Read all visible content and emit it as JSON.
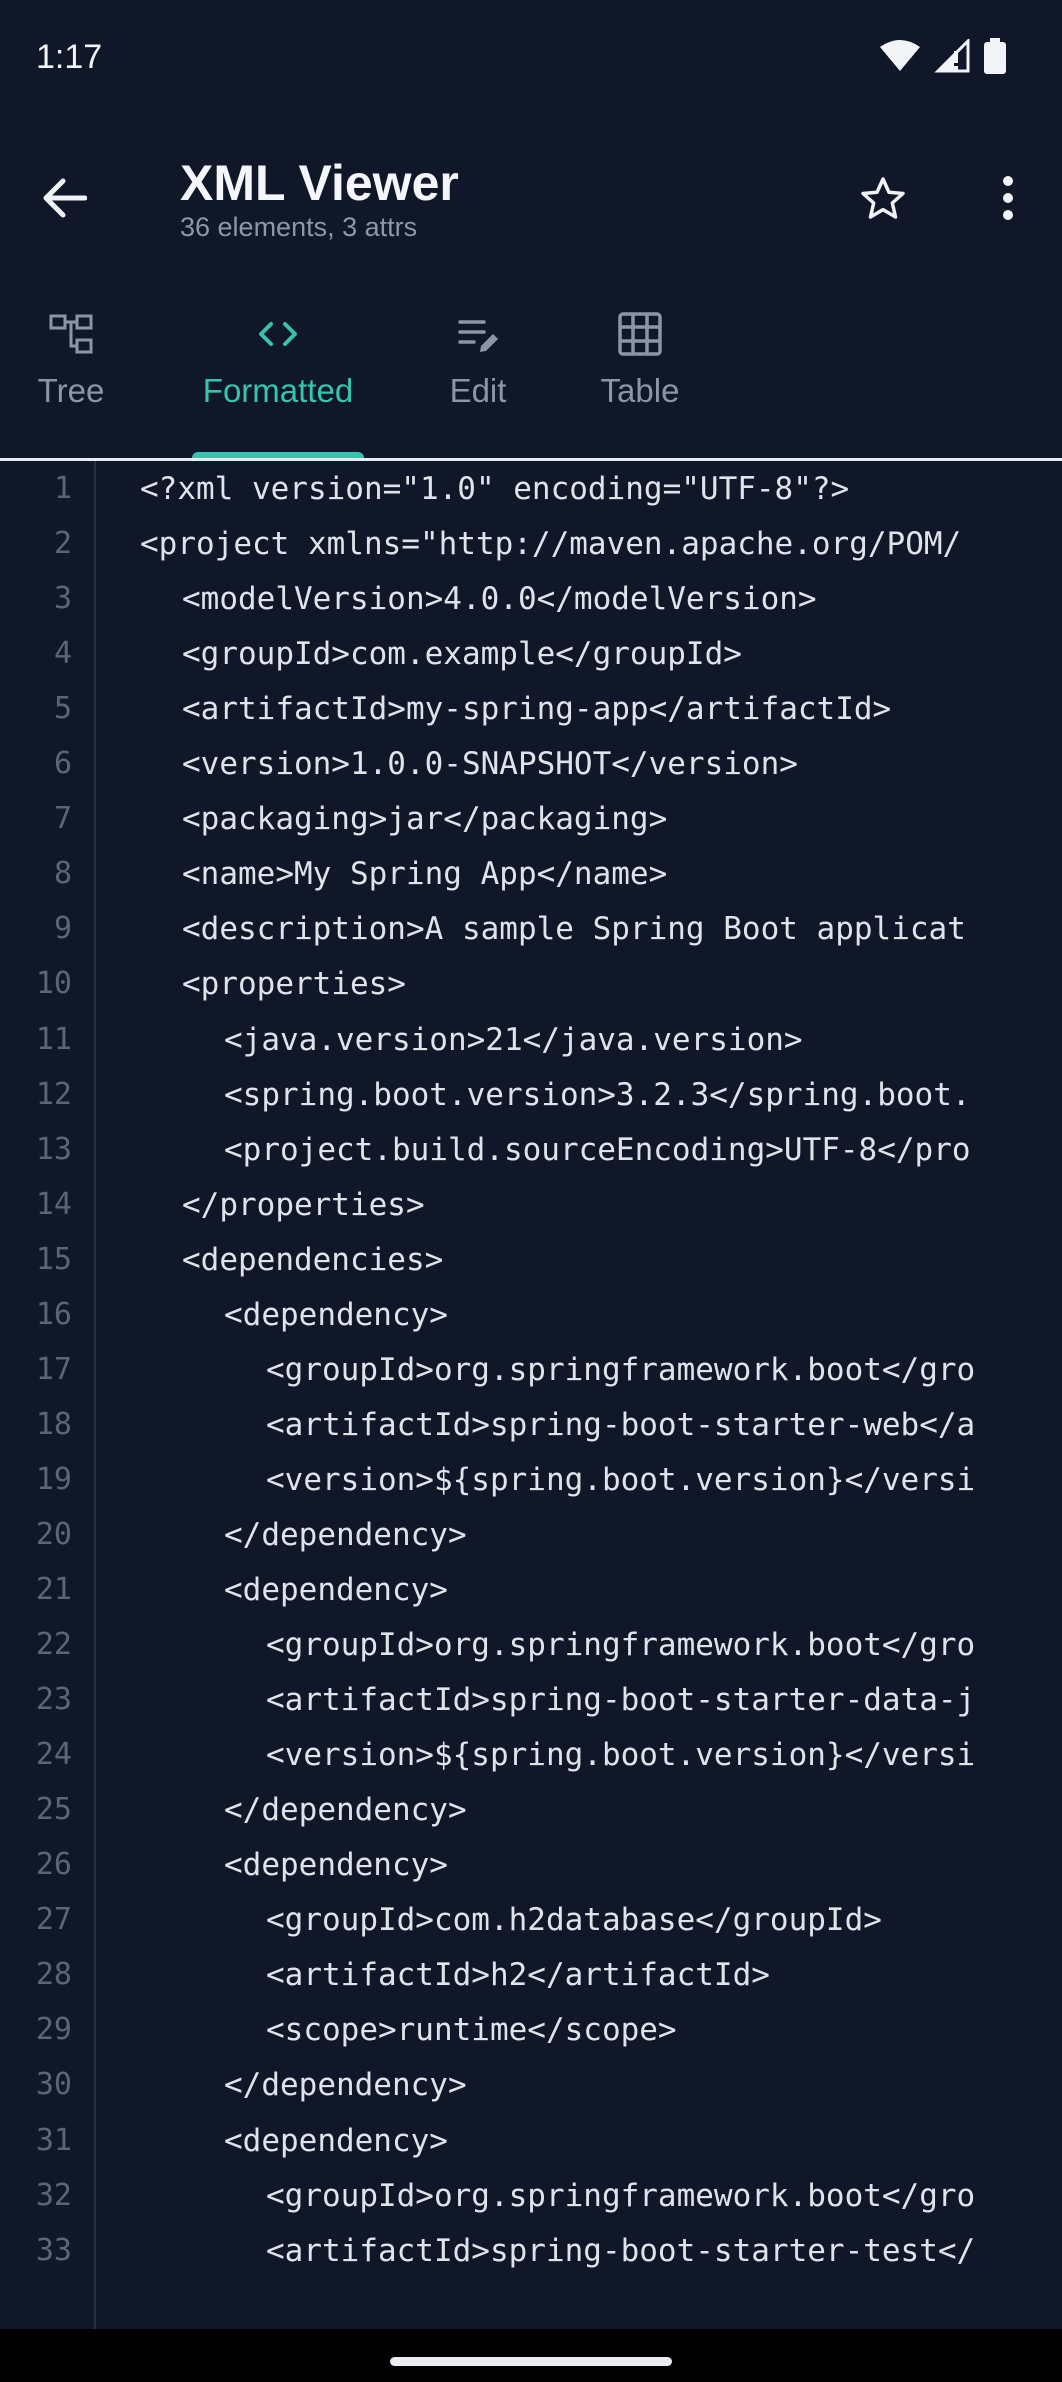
{
  "status_bar": {
    "time": "1:17"
  },
  "app_bar": {
    "title": "XML Viewer",
    "subtitle": "36 elements, 3 attrs"
  },
  "tabs": [
    {
      "label": "Tree",
      "icon": "tree-icon",
      "active": false
    },
    {
      "label": "Formatted",
      "icon": "code-icon",
      "active": true
    },
    {
      "label": "Edit",
      "icon": "edit-icon",
      "active": false
    },
    {
      "label": "Table",
      "icon": "table-icon",
      "active": false
    }
  ],
  "lines": [
    {
      "num": "1",
      "indent": 0,
      "code": "<?xml version=\"1.0\" encoding=\"UTF-8\"?>"
    },
    {
      "num": "2",
      "indent": 0,
      "code": "<project xmlns=\"http://maven.apache.org/POM/"
    },
    {
      "num": "3",
      "indent": 1,
      "code": "<modelVersion>4.0.0</modelVersion>"
    },
    {
      "num": "4",
      "indent": 1,
      "code": "<groupId>com.example</groupId>"
    },
    {
      "num": "5",
      "indent": 1,
      "code": "<artifactId>my-spring-app</artifactId>"
    },
    {
      "num": "6",
      "indent": 1,
      "code": "<version>1.0.0-SNAPSHOT</version>"
    },
    {
      "num": "7",
      "indent": 1,
      "code": "<packaging>jar</packaging>"
    },
    {
      "num": "8",
      "indent": 1,
      "code": "<name>My Spring App</name>"
    },
    {
      "num": "9",
      "indent": 1,
      "code": "<description>A sample Spring Boot applicat"
    },
    {
      "num": "10",
      "indent": 1,
      "code": "<properties>"
    },
    {
      "num": "11",
      "indent": 2,
      "code": "<java.version>21</java.version>"
    },
    {
      "num": "12",
      "indent": 2,
      "code": "<spring.boot.version>3.2.3</spring.boot."
    },
    {
      "num": "13",
      "indent": 2,
      "code": "<project.build.sourceEncoding>UTF-8</pro"
    },
    {
      "num": "14",
      "indent": 1,
      "code": "</properties>"
    },
    {
      "num": "15",
      "indent": 1,
      "code": "<dependencies>"
    },
    {
      "num": "16",
      "indent": 2,
      "code": "<dependency>"
    },
    {
      "num": "17",
      "indent": 3,
      "code": "<groupId>org.springframework.boot</gro"
    },
    {
      "num": "18",
      "indent": 3,
      "code": "<artifactId>spring-boot-starter-web</a"
    },
    {
      "num": "19",
      "indent": 3,
      "code": "<version>${spring.boot.version}</versi"
    },
    {
      "num": "20",
      "indent": 2,
      "code": "</dependency>"
    },
    {
      "num": "21",
      "indent": 2,
      "code": "<dependency>"
    },
    {
      "num": "22",
      "indent": 3,
      "code": "<groupId>org.springframework.boot</gro"
    },
    {
      "num": "23",
      "indent": 3,
      "code": "<artifactId>spring-boot-starter-data-j"
    },
    {
      "num": "24",
      "indent": 3,
      "code": "<version>${spring.boot.version}</versi"
    },
    {
      "num": "25",
      "indent": 2,
      "code": "</dependency>"
    },
    {
      "num": "26",
      "indent": 2,
      "code": "<dependency>"
    },
    {
      "num": "27",
      "indent": 3,
      "code": "<groupId>com.h2database</groupId>"
    },
    {
      "num": "28",
      "indent": 3,
      "code": "<artifactId>h2</artifactId>"
    },
    {
      "num": "29",
      "indent": 3,
      "code": "<scope>runtime</scope>"
    },
    {
      "num": "30",
      "indent": 2,
      "code": "</dependency>"
    },
    {
      "num": "31",
      "indent": 2,
      "code": "<dependency>"
    },
    {
      "num": "32",
      "indent": 3,
      "code": "<groupId>org.springframework.boot</gro"
    },
    {
      "num": "33",
      "indent": 3,
      "code": "<artifactId>spring-boot-starter-test</"
    }
  ],
  "colors": {
    "background": "#0f1729",
    "accent": "#36c4b0"
  }
}
